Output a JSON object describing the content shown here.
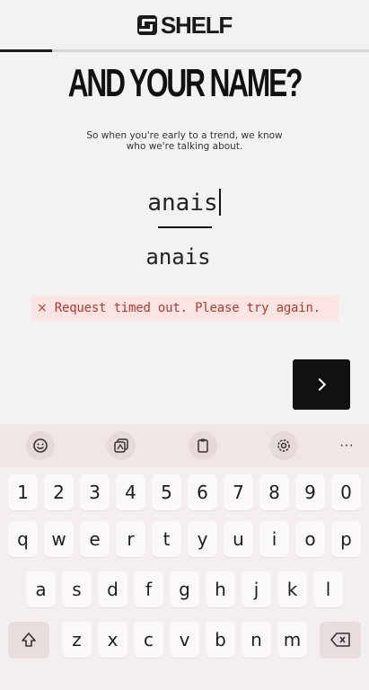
{
  "header": {
    "logo_text": "SHELF"
  },
  "progress": {
    "fraction": 0.14
  },
  "title": "AND YOUR NAME?",
  "subtitle_line1": "So when you're early to a trend, we know",
  "subtitle_line2": "who we're talking about.",
  "name_input": {
    "value": "anais"
  },
  "echo_name": "anais",
  "error": {
    "icon": "×",
    "text": "Request timed out. Please try again."
  },
  "next_button": {
    "icon": "chevron-right-icon"
  },
  "keyboard": {
    "toolbar": [
      "emoji-icon",
      "sticker-icon",
      "clipboard-icon",
      "settings-icon",
      "more-icon"
    ],
    "more_label": "···",
    "row_numbers": [
      "1",
      "2",
      "3",
      "4",
      "5",
      "6",
      "7",
      "8",
      "9",
      "0"
    ],
    "row1": [
      "q",
      "w",
      "e",
      "r",
      "t",
      "y",
      "u",
      "i",
      "o",
      "p"
    ],
    "row2": [
      "a",
      "s",
      "d",
      "f",
      "g",
      "h",
      "j",
      "k",
      "l"
    ],
    "row3": [
      "z",
      "x",
      "c",
      "v",
      "b",
      "n",
      "m"
    ]
  }
}
